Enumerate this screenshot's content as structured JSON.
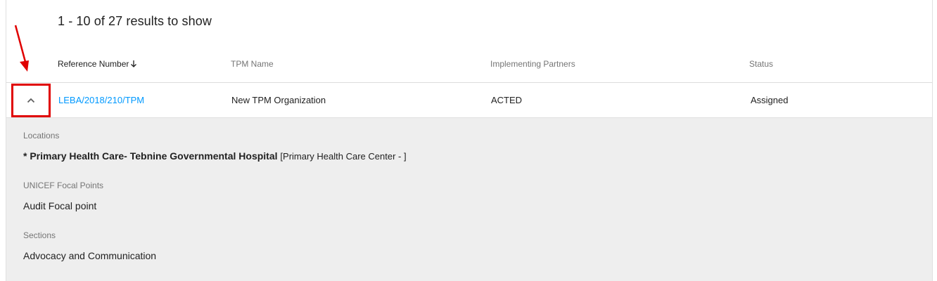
{
  "results": {
    "summary": "1 - 10 of 27 results to show"
  },
  "table": {
    "columns": [
      {
        "label": "Reference Number",
        "sorted": true,
        "sort_direction": "descending"
      },
      {
        "label": "TPM Name"
      },
      {
        "label": "Implementing Partners"
      },
      {
        "label": "Status"
      }
    ],
    "rows": [
      {
        "reference_number": "LEBA/2018/210/TPM",
        "tpm_name": "New TPM Organization",
        "implementing_partners": "ACTED",
        "status": "Assigned",
        "expanded": true,
        "details": {
          "locations_label": "Locations",
          "location_prefix": "* ",
          "location_name": "Primary Health Care- Tebnine Governmental Hospital",
          "location_type": "[Primary Health Care Center - ]",
          "focal_points_label": "UNICEF Focal Points",
          "focal_points_value": "Audit Focal point",
          "sections_label": "Sections",
          "sections_value": "Advocacy and Communication"
        }
      }
    ]
  },
  "colors": {
    "link": "#0099ff",
    "annotation": "#e00000",
    "details_bg": "#eeeeee"
  },
  "icons": {
    "sort": "arrow-down-icon",
    "expand": "chevron-up-icon",
    "annotation": "red-arrow-icon"
  }
}
